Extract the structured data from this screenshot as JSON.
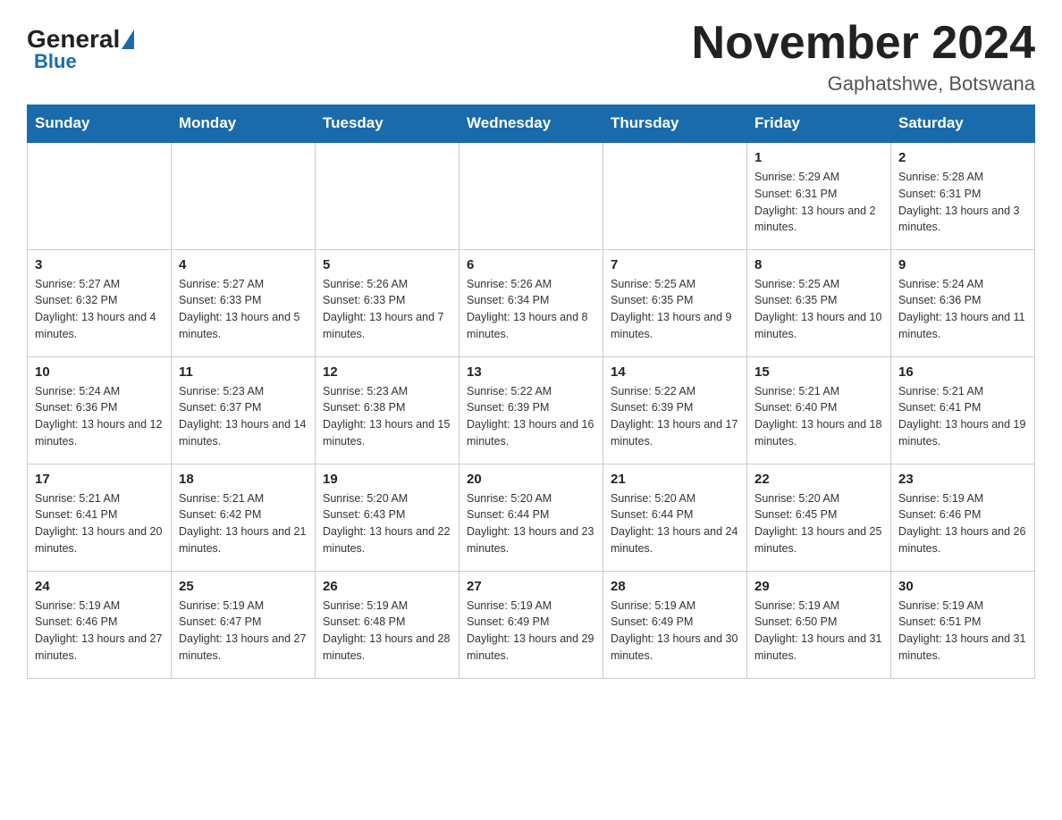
{
  "header": {
    "logo": {
      "general": "General",
      "blue": "Blue"
    },
    "title": "November 2024",
    "subtitle": "Gaphatshwe, Botswana"
  },
  "days_of_week": [
    "Sunday",
    "Monday",
    "Tuesday",
    "Wednesday",
    "Thursday",
    "Friday",
    "Saturday"
  ],
  "weeks": [
    [
      {
        "day": "",
        "info": ""
      },
      {
        "day": "",
        "info": ""
      },
      {
        "day": "",
        "info": ""
      },
      {
        "day": "",
        "info": ""
      },
      {
        "day": "",
        "info": ""
      },
      {
        "day": "1",
        "info": "Sunrise: 5:29 AM\nSunset: 6:31 PM\nDaylight: 13 hours and 2 minutes."
      },
      {
        "day": "2",
        "info": "Sunrise: 5:28 AM\nSunset: 6:31 PM\nDaylight: 13 hours and 3 minutes."
      }
    ],
    [
      {
        "day": "3",
        "info": "Sunrise: 5:27 AM\nSunset: 6:32 PM\nDaylight: 13 hours and 4 minutes."
      },
      {
        "day": "4",
        "info": "Sunrise: 5:27 AM\nSunset: 6:33 PM\nDaylight: 13 hours and 5 minutes."
      },
      {
        "day": "5",
        "info": "Sunrise: 5:26 AM\nSunset: 6:33 PM\nDaylight: 13 hours and 7 minutes."
      },
      {
        "day": "6",
        "info": "Sunrise: 5:26 AM\nSunset: 6:34 PM\nDaylight: 13 hours and 8 minutes."
      },
      {
        "day": "7",
        "info": "Sunrise: 5:25 AM\nSunset: 6:35 PM\nDaylight: 13 hours and 9 minutes."
      },
      {
        "day": "8",
        "info": "Sunrise: 5:25 AM\nSunset: 6:35 PM\nDaylight: 13 hours and 10 minutes."
      },
      {
        "day": "9",
        "info": "Sunrise: 5:24 AM\nSunset: 6:36 PM\nDaylight: 13 hours and 11 minutes."
      }
    ],
    [
      {
        "day": "10",
        "info": "Sunrise: 5:24 AM\nSunset: 6:36 PM\nDaylight: 13 hours and 12 minutes."
      },
      {
        "day": "11",
        "info": "Sunrise: 5:23 AM\nSunset: 6:37 PM\nDaylight: 13 hours and 14 minutes."
      },
      {
        "day": "12",
        "info": "Sunrise: 5:23 AM\nSunset: 6:38 PM\nDaylight: 13 hours and 15 minutes."
      },
      {
        "day": "13",
        "info": "Sunrise: 5:22 AM\nSunset: 6:39 PM\nDaylight: 13 hours and 16 minutes."
      },
      {
        "day": "14",
        "info": "Sunrise: 5:22 AM\nSunset: 6:39 PM\nDaylight: 13 hours and 17 minutes."
      },
      {
        "day": "15",
        "info": "Sunrise: 5:21 AM\nSunset: 6:40 PM\nDaylight: 13 hours and 18 minutes."
      },
      {
        "day": "16",
        "info": "Sunrise: 5:21 AM\nSunset: 6:41 PM\nDaylight: 13 hours and 19 minutes."
      }
    ],
    [
      {
        "day": "17",
        "info": "Sunrise: 5:21 AM\nSunset: 6:41 PM\nDaylight: 13 hours and 20 minutes."
      },
      {
        "day": "18",
        "info": "Sunrise: 5:21 AM\nSunset: 6:42 PM\nDaylight: 13 hours and 21 minutes."
      },
      {
        "day": "19",
        "info": "Sunrise: 5:20 AM\nSunset: 6:43 PM\nDaylight: 13 hours and 22 minutes."
      },
      {
        "day": "20",
        "info": "Sunrise: 5:20 AM\nSunset: 6:44 PM\nDaylight: 13 hours and 23 minutes."
      },
      {
        "day": "21",
        "info": "Sunrise: 5:20 AM\nSunset: 6:44 PM\nDaylight: 13 hours and 24 minutes."
      },
      {
        "day": "22",
        "info": "Sunrise: 5:20 AM\nSunset: 6:45 PM\nDaylight: 13 hours and 25 minutes."
      },
      {
        "day": "23",
        "info": "Sunrise: 5:19 AM\nSunset: 6:46 PM\nDaylight: 13 hours and 26 minutes."
      }
    ],
    [
      {
        "day": "24",
        "info": "Sunrise: 5:19 AM\nSunset: 6:46 PM\nDaylight: 13 hours and 27 minutes."
      },
      {
        "day": "25",
        "info": "Sunrise: 5:19 AM\nSunset: 6:47 PM\nDaylight: 13 hours and 27 minutes."
      },
      {
        "day": "26",
        "info": "Sunrise: 5:19 AM\nSunset: 6:48 PM\nDaylight: 13 hours and 28 minutes."
      },
      {
        "day": "27",
        "info": "Sunrise: 5:19 AM\nSunset: 6:49 PM\nDaylight: 13 hours and 29 minutes."
      },
      {
        "day": "28",
        "info": "Sunrise: 5:19 AM\nSunset: 6:49 PM\nDaylight: 13 hours and 30 minutes."
      },
      {
        "day": "29",
        "info": "Sunrise: 5:19 AM\nSunset: 6:50 PM\nDaylight: 13 hours and 31 minutes."
      },
      {
        "day": "30",
        "info": "Sunrise: 5:19 AM\nSunset: 6:51 PM\nDaylight: 13 hours and 31 minutes."
      }
    ]
  ]
}
